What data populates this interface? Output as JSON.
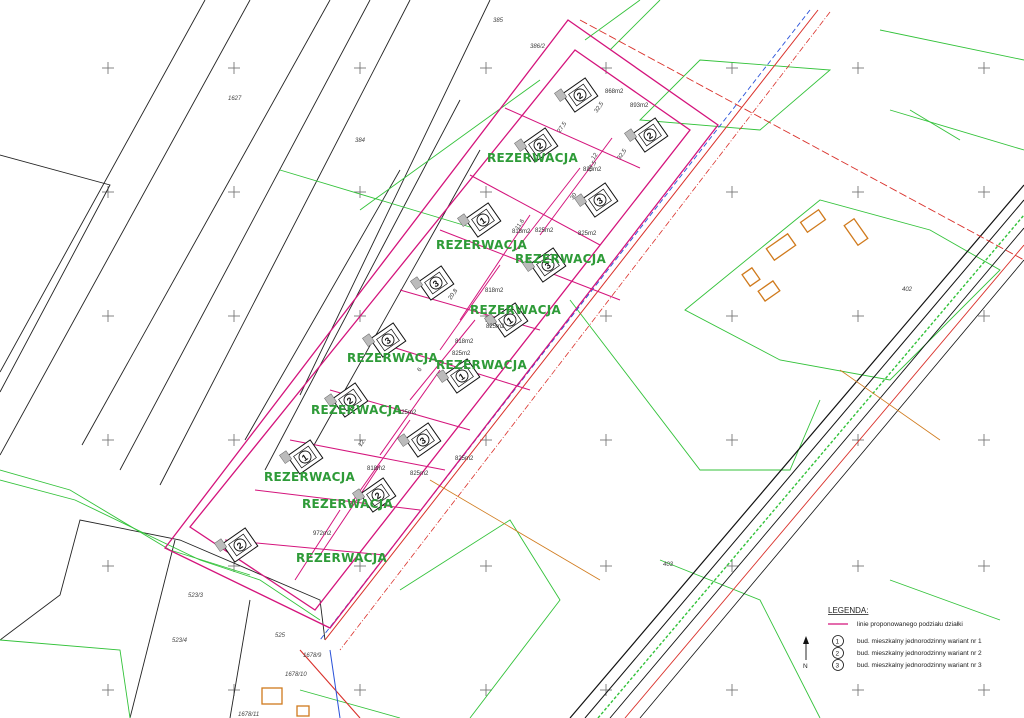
{
  "parcels": {
    "p385": "385",
    "p386_2": "386/2",
    "p1627": "1627",
    "p384": "384",
    "p402": "402",
    "p403": "403",
    "p523_3": "523/3",
    "p523_4": "523/4",
    "p525": "525",
    "p1678_9": "1678/9",
    "p1678_10": "1678/10",
    "p1678_11": "1678/11"
  },
  "lots": [
    {
      "area": "868m2",
      "variant": "2",
      "reserved": false
    },
    {
      "area": "893m2",
      "variant": "2",
      "reserved": false
    },
    {
      "area": "825m2",
      "variant": "2",
      "reserved": true
    },
    {
      "area": "825m2",
      "variant": "3",
      "reserved": false
    },
    {
      "area": "818m2",
      "variant": "1",
      "reserved": true
    },
    {
      "area": "825m2",
      "variant": "3",
      "reserved": true
    },
    {
      "area": "818m2",
      "variant": "3",
      "reserved": false
    },
    {
      "area": "825m2",
      "variant": "1",
      "reserved": true
    },
    {
      "area": "818m2",
      "variant": "3",
      "reserved": true
    },
    {
      "area": "825m2",
      "variant": "1",
      "reserved": true
    },
    {
      "area": "825m2",
      "variant": "2",
      "reserved": true
    },
    {
      "area": "825m2",
      "variant": "3",
      "reserved": false
    },
    {
      "area": "818m2",
      "variant": "1",
      "reserved": true
    },
    {
      "area": "825m2",
      "variant": "2",
      "reserved": true
    },
    {
      "area": "972m2",
      "variant": "2",
      "reserved": true
    }
  ],
  "reservation_label": "REZERWACJA",
  "dimensions": [
    "27,5",
    "32,5",
    "12",
    "30",
    "20,8",
    "11,6",
    "6",
    "12",
    "27,5",
    "32,5"
  ],
  "legend": {
    "title": "LEGENDA:",
    "line_label": "linie proponowanego podziału działki",
    "items": [
      {
        "num": "1",
        "label": "bud. mieszkalny jednorodzinny wariant nr 1"
      },
      {
        "num": "2",
        "label": "bud. mieszkalny jednorodzinny wariant nr 2"
      },
      {
        "num": "3",
        "label": "bud. mieszkalny jednorodzinny wariant nr 3"
      }
    ]
  },
  "north_label": "N",
  "colors": {
    "subdivision": "#d4147c",
    "reservation": "#2e9b38",
    "boundary_green": "#33c23a",
    "road_red": "#d9302a",
    "utility_blue": "#2a52d9",
    "building_orange": "#d07a1c",
    "grid_black": "#111111"
  }
}
